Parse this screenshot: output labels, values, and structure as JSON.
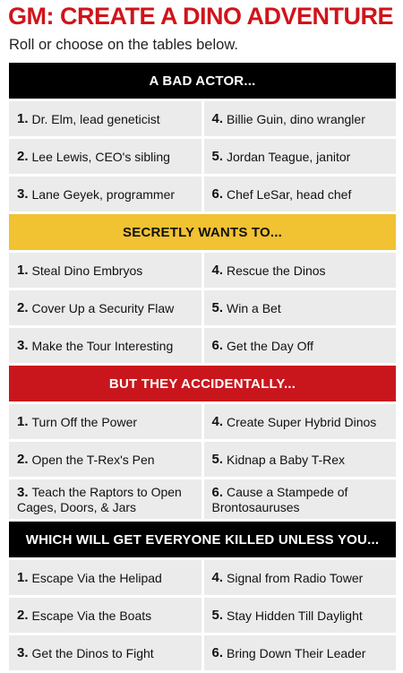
{
  "title": "GM: CREATE A DINO ADVENTURE",
  "subtitle": "Roll or choose on the tables below.",
  "colors": {
    "title_red": "#d0141a",
    "black": "#000000",
    "yellow": "#f1c232",
    "red": "#c9161c",
    "cell_gray": "#ebebeb"
  },
  "sections": [
    {
      "header": "A BAD ACTOR...",
      "rows": [
        [
          "1.",
          "Dr. Elm, lead geneticist",
          "4.",
          "Billie Guin, dino wrangler"
        ],
        [
          "2.",
          "Lee Lewis, CEO's sibling",
          "5.",
          "Jordan Teague, janitor"
        ],
        [
          "3.",
          "Lane Geyek, programmer",
          "6.",
          "Chef LeSar, head chef"
        ]
      ]
    },
    {
      "header": "SECRETLY WANTS TO...",
      "rows": [
        [
          "1.",
          "Steal Dino Embryos",
          "4.",
          "Rescue the Dinos"
        ],
        [
          "2.",
          "Cover Up a Security Flaw",
          "5.",
          "Win a Bet"
        ],
        [
          "3.",
          "Make the Tour Interesting",
          "6.",
          "Get the Day Off"
        ]
      ]
    },
    {
      "header": "BUT THEY ACCIDENTALLY...",
      "rows": [
        [
          "1.",
          "Turn Off the Power",
          "4.",
          "Create Super Hybrid Dinos"
        ],
        [
          "2.",
          "Open the T-Rex's Pen",
          "5.",
          "Kidnap a Baby T-Rex"
        ],
        [
          "3.",
          "Teach the Raptors to Open Cages, Doors, & Jars",
          "6.",
          "Cause a Stampede of Brontosauruses"
        ]
      ]
    },
    {
      "header": "WHICH WILL GET EVERYONE KILLED UNLESS YOU...",
      "rows": [
        [
          "1.",
          "Escape Via the Helipad",
          "4.",
          "Signal from Radio Tower"
        ],
        [
          "2.",
          "Escape Via the Boats",
          "5.",
          "Stay Hidden Till Daylight"
        ],
        [
          "3.",
          "Get the Dinos to Fight",
          "6.",
          "Bring Down Their Leader"
        ]
      ]
    }
  ]
}
